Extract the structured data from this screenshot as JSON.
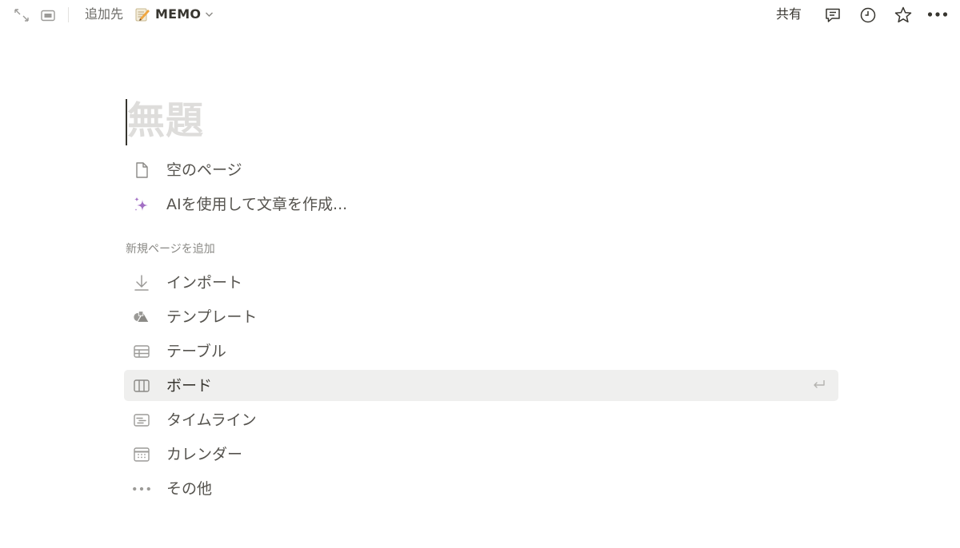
{
  "topbar": {
    "prefix": "追加先",
    "target_name": "MEMO",
    "share_label": "共有",
    "icons": [
      "expand-icon",
      "peek-mode-icon",
      "memo-emoji-icon",
      "chevron-down-icon",
      "comment-icon",
      "clock-icon",
      "star-icon",
      "more-icon"
    ]
  },
  "page": {
    "title_placeholder": "無題"
  },
  "quick_actions": [
    {
      "label": "空のページ",
      "icon": "page-icon"
    },
    {
      "label": "AIを使用して文章を作成...",
      "icon": "ai-sparkle-icon"
    }
  ],
  "new_page_section": {
    "heading": "新規ページを追加",
    "items": [
      {
        "label": "インポート",
        "icon": "import-icon"
      },
      {
        "label": "テンプレート",
        "icon": "template-icon"
      },
      {
        "label": "テーブル",
        "icon": "table-icon"
      },
      {
        "label": "ボード",
        "icon": "board-icon",
        "selected": true
      },
      {
        "label": "タイムライン",
        "icon": "timeline-icon"
      },
      {
        "label": "カレンダー",
        "icon": "calendar-icon"
      },
      {
        "label": "その他",
        "icon": "more-icon"
      }
    ]
  },
  "colors": {
    "accent_ai": "#a26fc4",
    "selected_bg": "#efefee",
    "placeholder": "#dedddb"
  }
}
